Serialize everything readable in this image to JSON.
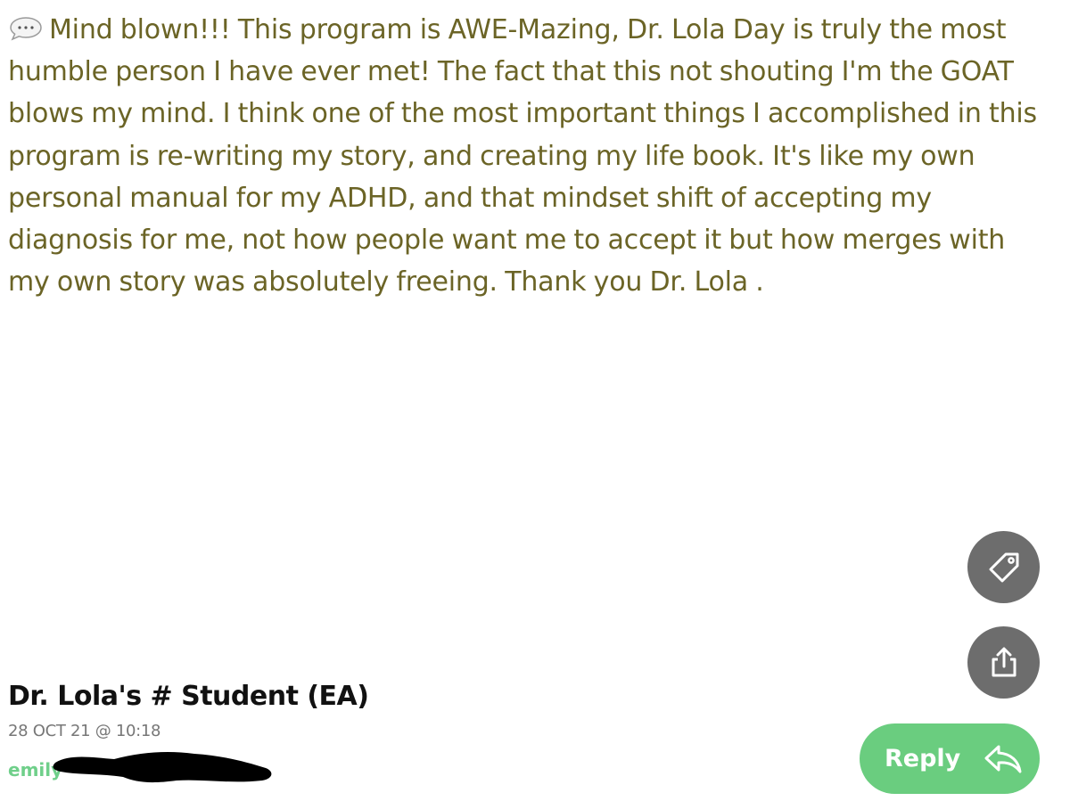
{
  "post": {
    "message": "Mind blown!!! This program is AWE-Mazing, Dr. Lola Day is truly the most humble person I have ever met! The fact that this not shouting I'm the GOAT blows my mind. I think one of the most important things I accomplished in this program is re-writing my story, and creating my life book. It's like my own personal manual for my ADHD, and that mindset shift of accepting my diagnosis for me, not how people want me to accept it but how merges with my own story was absolutely freeing. Thank you Dr. Lola .",
    "message_icon": "speech-bubble-icon",
    "author": "Dr. Lola's # Student (EA)",
    "timestamp": "28 OCT 21 @ 10:18",
    "email_visible": "emily"
  },
  "actions": {
    "tag_icon": "tag-icon",
    "share_icon": "share-icon",
    "reply_label": "Reply",
    "reply_icon": "reply-arrow-icon"
  },
  "colors": {
    "message_text": "#6b6426",
    "action_button": "#6d6d6d",
    "reply_button": "#6acd7f",
    "email_text": "#6fcf8a"
  }
}
